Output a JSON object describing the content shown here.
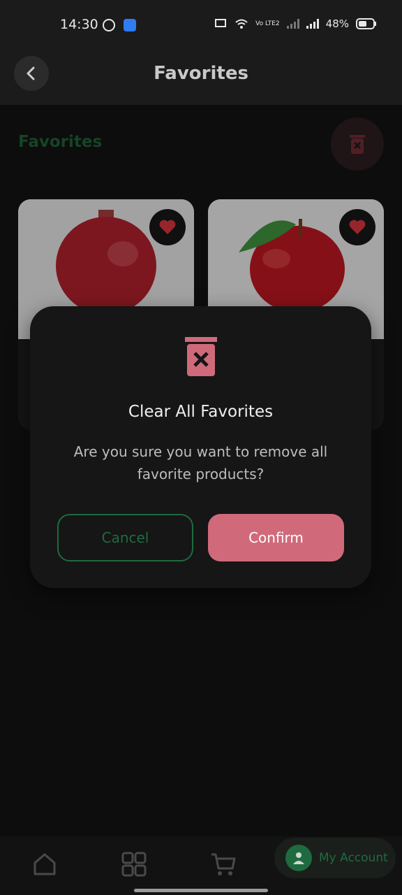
{
  "status_bar": {
    "time": "14:30",
    "battery": "48%",
    "network": "Vo LTE2"
  },
  "app_bar": {
    "title": "Favorites"
  },
  "section": {
    "title": "Favorites"
  },
  "products": [
    {
      "name": "Pomegranate",
      "favorited": true
    },
    {
      "name": "Apple",
      "favorited": true
    }
  ],
  "modal": {
    "title": "Clear All Favorites",
    "message": "Are you sure you want to remove all favorite products?",
    "cancel_label": "Cancel",
    "confirm_label": "Confirm"
  },
  "bottom_nav": {
    "account_label": "My Account"
  },
  "colors": {
    "accent_green": "#1f6b3f",
    "danger_pink": "#d06a7b",
    "heart_red": "#c8333b"
  }
}
